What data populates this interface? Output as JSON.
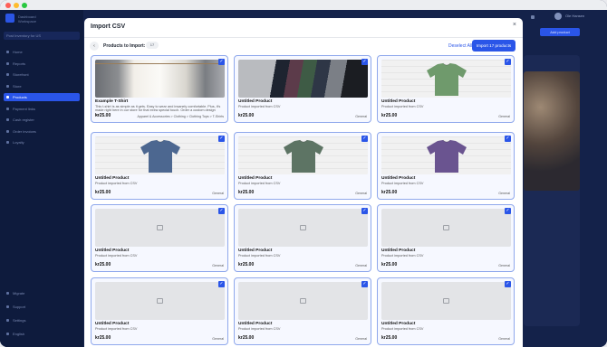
{
  "window": {
    "dots": [
      "#fe5f57",
      "#febc2e",
      "#28c840"
    ]
  },
  "sidebar": {
    "brand": [
      "Dashboard",
      "Workspace"
    ],
    "workspace": "Post Inventory for US",
    "items": [
      {
        "label": "Home",
        "active": false
      },
      {
        "label": "Reports",
        "active": false
      },
      {
        "label": "Storefront",
        "active": false
      },
      {
        "label": "Store",
        "active": false
      },
      {
        "label": "Products",
        "active": true
      },
      {
        "label": "Payment links",
        "active": false
      },
      {
        "label": "Cash register",
        "active": false
      },
      {
        "label": "Order invoices",
        "active": false
      },
      {
        "label": "Loyalty",
        "active": false
      }
    ],
    "bottom_items": [
      "Migrate",
      "Support",
      "Settings",
      "English"
    ]
  },
  "header": {
    "user": "Ole Hansen",
    "cta": "Add product"
  },
  "modal": {
    "title": "Import CSV",
    "close": "×",
    "subheading": "Products to Import:",
    "count": "17",
    "deselect": "Deselect All",
    "import_button": "Import 17 products",
    "colors": {
      "accent": "#2a55e8",
      "selected_border": "#8fa8ec"
    },
    "products": [
      {
        "name": "Example T-Shirt",
        "description": "This t-shirt is as simple as it gets. Easy to wear and insanely comfortable. Plus, it's made right here in our store for that extra special touch. Order a custom design or...",
        "price": "kr25.00",
        "category": "Apparel & Accessories > Clothing > Clothing Tops > T-Shirts",
        "image": "hanging-shirts"
      },
      {
        "name": "Untitled Product",
        "description": "Product imported from CSV",
        "price": "kr25.00",
        "category": "General",
        "image": "folded-shirts"
      },
      {
        "name": "Untitled Product",
        "description": "Product imported from CSV",
        "price": "kr25.00",
        "category": "General",
        "image": "green-shirt"
      },
      {
        "name": "Untitled Product",
        "description": "Product imported from CSV",
        "price": "kr25.00",
        "category": "General",
        "image": "blue-shirt"
      },
      {
        "name": "Untitled Product",
        "description": "Product imported from CSV",
        "price": "kr25.00",
        "category": "General",
        "image": "gray-green-shirt"
      },
      {
        "name": "Untitled Product",
        "description": "Product imported from CSV",
        "price": "kr25.00",
        "category": "General",
        "image": "purple-shirt"
      },
      {
        "name": "Untitled Product",
        "description": "Product imported from CSV",
        "price": "kr25.00",
        "category": "General",
        "image": "placeholder"
      },
      {
        "name": "Untitled Product",
        "description": "Product imported from CSV",
        "price": "kr25.00",
        "category": "General",
        "image": "placeholder"
      },
      {
        "name": "Untitled Product",
        "description": "Product imported from CSV",
        "price": "kr25.00",
        "category": "General",
        "image": "placeholder"
      },
      {
        "name": "Untitled Product",
        "description": "Product imported from CSV",
        "price": "kr25.00",
        "category": "General",
        "image": "placeholder"
      },
      {
        "name": "Untitled Product",
        "description": "Product imported from CSV",
        "price": "kr25.00",
        "category": "General",
        "image": "placeholder"
      },
      {
        "name": "Untitled Product",
        "description": "Product imported from CSV",
        "price": "kr25.00",
        "category": "General",
        "image": "placeholder"
      }
    ]
  }
}
